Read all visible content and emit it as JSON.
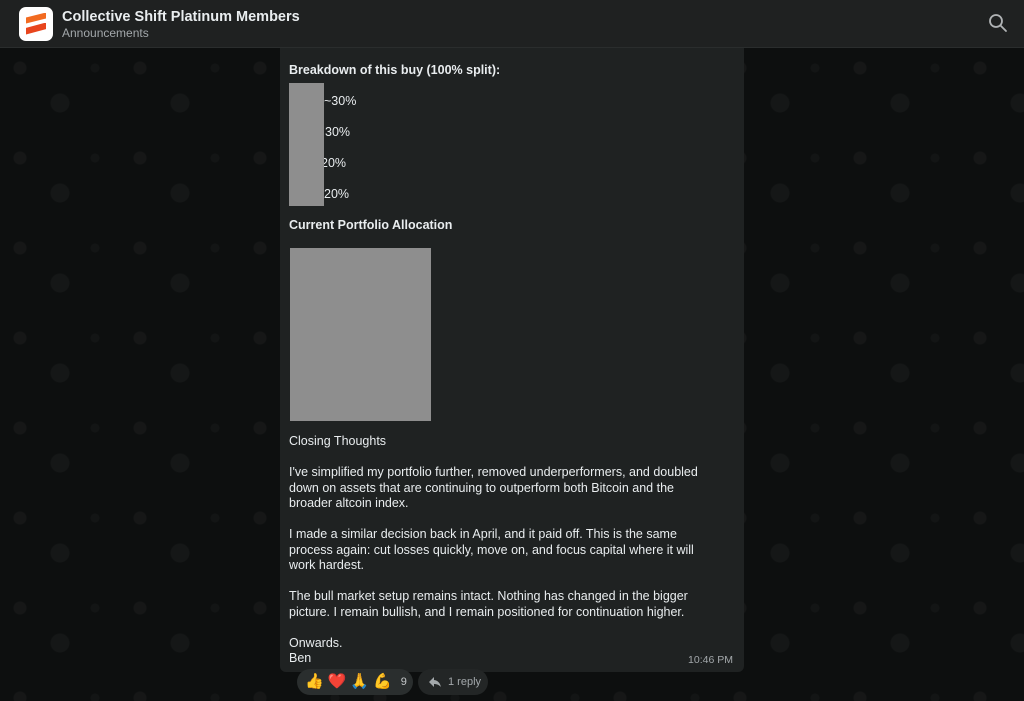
{
  "header": {
    "title": "Collective Shift Platinum Members",
    "subtitle": "Announcements"
  },
  "message": {
    "breakdown_title": "Breakdown of this buy (100% split):",
    "breakdown_items": [
      "~30%",
      "30%",
      "20%",
      "20%"
    ],
    "portfolio_title": "Current Portfolio Allocation",
    "closing_title": "Closing Thoughts",
    "para1_l1": "I've simplified my portfolio further, removed underperformers, and doubled",
    "para1_l2": "down on assets that are continuing to outperform both Bitcoin and the",
    "para1_l3": "broader altcoin index.",
    "para2_l1": "I made a similar decision back in April, and it paid off. This is the same",
    "para2_l2": "process again: cut losses quickly, move on, and focus capital where it will",
    "para2_l3": "work hardest.",
    "para3_l1": "The bull market setup remains intact. Nothing has changed in the bigger",
    "para3_l2": "picture. I remain bullish, and I remain positioned for continuation higher.",
    "signoff": "Onwards.",
    "author": "Ben",
    "time": "10:46 PM"
  },
  "reactions": {
    "emojis": [
      "👍",
      "❤️",
      "🙏",
      "💪"
    ],
    "count": "9"
  },
  "reply": {
    "label": "1 reply"
  }
}
